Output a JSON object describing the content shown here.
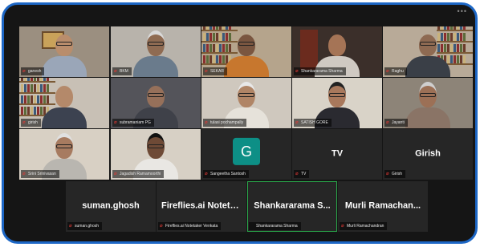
{
  "window": {
    "menu_dots": "•••"
  },
  "participants": [
    {
      "name": "ganesh",
      "mic": "muted"
    },
    {
      "name": "BKM",
      "mic": "muted"
    },
    {
      "name": "SEKAR",
      "mic": "muted"
    },
    {
      "name": "Shankararama Sharma",
      "mic": "muted"
    },
    {
      "name": "Raghu",
      "mic": "muted"
    },
    {
      "name": "girish",
      "mic": "muted"
    },
    {
      "name": "subramaniam PG",
      "mic": "muted"
    },
    {
      "name": "tulasi pochampally",
      "mic": "muted"
    },
    {
      "name": "SATISH GORE",
      "mic": "muted"
    },
    {
      "name": "Jayanti",
      "mic": "muted"
    },
    {
      "name": "Srini Srinivasan",
      "mic": "muted"
    },
    {
      "name": "Jagadish Ramamoorthi",
      "mic": "muted"
    },
    {
      "name": "Sangeetha Santosh",
      "mic": "muted",
      "avatar": "G",
      "avatar_color": "#0d8f86"
    },
    {
      "name": "TV",
      "display": "TV",
      "mic": "muted"
    },
    {
      "name": "Girish",
      "display": "Girish",
      "mic": "muted"
    },
    {
      "name": "suman.ghosh",
      "display": "suman.ghosh",
      "mic": "muted"
    },
    {
      "name": "Fireflies.ai Notetaker Venkata",
      "display": "Fireflies.ai  Notetake...",
      "mic": "muted"
    },
    {
      "name": "Shankararama Sharma",
      "display": "Shankararama  S...",
      "mic": "on"
    },
    {
      "name": "Murli Ramachandran",
      "display": "Murli  Ramachan...",
      "mic": "muted"
    }
  ],
  "colors": {
    "frame_border": "#1d67c6",
    "active_speaker": "#2aa84a",
    "mic_muted": "#e53935"
  }
}
